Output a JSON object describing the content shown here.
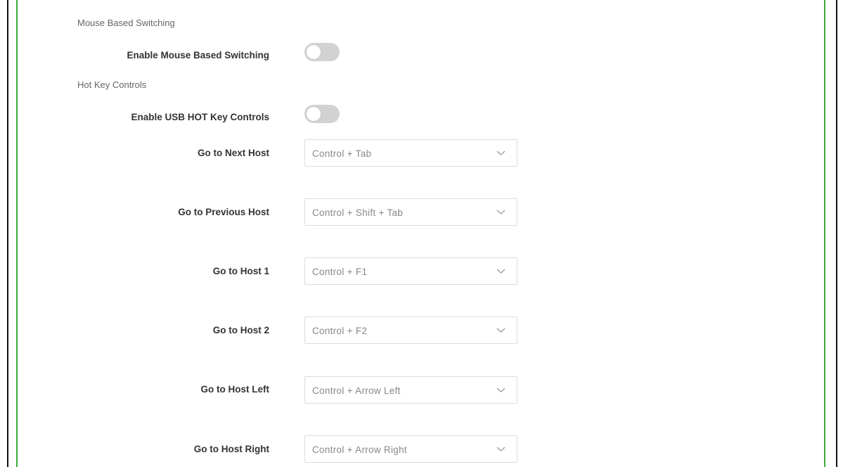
{
  "sections": {
    "mouse": {
      "title": "Mouse Based Switching",
      "toggle_label": "Enable Mouse Based Switching",
      "toggle_on": false
    },
    "hotkey": {
      "title": "Hot Key Controls",
      "toggle_label": "Enable USB HOT Key Controls",
      "toggle_on": false
    }
  },
  "hotkeys": [
    {
      "label": "Go to Next Host",
      "value": "Control + Tab"
    },
    {
      "label": "Go to Previous Host",
      "value": "Control + Shift + Tab"
    },
    {
      "label": "Go to Host 1",
      "value": "Control + F1"
    },
    {
      "label": "Go to Host 2",
      "value": "Control + F2"
    },
    {
      "label": "Go to Host Left",
      "value": "Control + Arrow Left"
    },
    {
      "label": "Go to Host Right",
      "value": "Control + Arrow Right"
    }
  ],
  "colors": {
    "accent_border": "#3cab3c",
    "toggle_off": "#d2d2d2",
    "label_text": "#333333",
    "muted_text": "#888888"
  },
  "icons": {
    "select_arrow": "chevron-down-icon"
  }
}
